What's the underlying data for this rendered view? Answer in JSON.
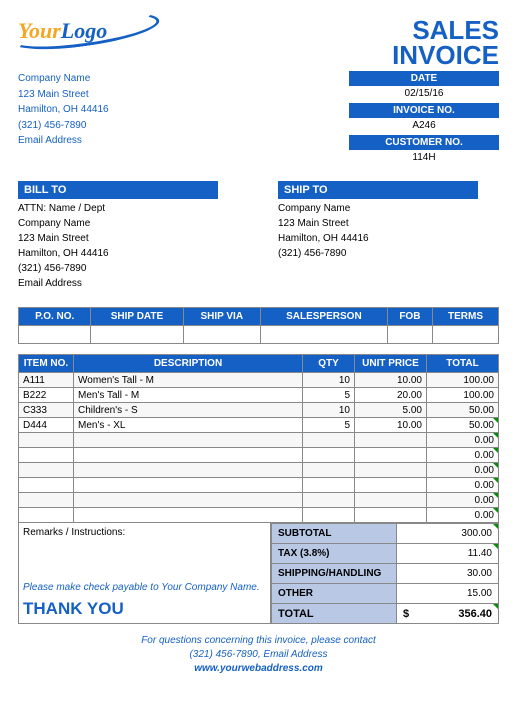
{
  "logo": {
    "word1": "Your",
    "word2": "Logo"
  },
  "title": {
    "line1": "SALES",
    "line2": "INVOICE"
  },
  "company": {
    "name": "Company Name",
    "street": "123 Main Street",
    "city": "Hamilton, OH  44416",
    "phone": "(321) 456-7890",
    "email": "Email Address"
  },
  "meta": {
    "date_label": "DATE",
    "date_value": "02/15/16",
    "invoice_label": "INVOICE NO.",
    "invoice_value": "A246",
    "customer_label": "CUSTOMER NO.",
    "customer_value": "114H"
  },
  "billto": {
    "header": "BILL TO",
    "attn": "ATTN: Name / Dept",
    "company": "Company Name",
    "street": "123 Main Street",
    "city": "Hamilton, OH  44416",
    "phone": "(321) 456-7890",
    "email": "Email Address"
  },
  "shipto": {
    "header": "SHIP TO",
    "company": "Company Name",
    "street": "123 Main Street",
    "city": "Hamilton, OH  44416",
    "phone": "(321) 456-7890"
  },
  "shiphdr": {
    "po": "P.O. NO.",
    "shipdate": "SHIP DATE",
    "shipvia": "SHIP VIA",
    "salesperson": "SALESPERSON",
    "fob": "FOB",
    "terms": "TERMS"
  },
  "itemshdr": {
    "item": "ITEM NO.",
    "desc": "DESCRIPTION",
    "qty": "QTY",
    "unit": "UNIT PRICE",
    "total": "TOTAL"
  },
  "items": [
    {
      "no": "A111",
      "desc": "Women's Tall - M",
      "qty": "10",
      "unit": "10.00",
      "total": "100.00"
    },
    {
      "no": "B222",
      "desc": "Men's Tall - M",
      "qty": "5",
      "unit": "20.00",
      "total": "100.00"
    },
    {
      "no": "C333",
      "desc": "Children's - S",
      "qty": "10",
      "unit": "5.00",
      "total": "50.00"
    },
    {
      "no": "D444",
      "desc": "Men's - XL",
      "qty": "5",
      "unit": "10.00",
      "total": "50.00"
    },
    {
      "no": "",
      "desc": "",
      "qty": "",
      "unit": "",
      "total": "0.00"
    },
    {
      "no": "",
      "desc": "",
      "qty": "",
      "unit": "",
      "total": "0.00"
    },
    {
      "no": "",
      "desc": "",
      "qty": "",
      "unit": "",
      "total": "0.00"
    },
    {
      "no": "",
      "desc": "",
      "qty": "",
      "unit": "",
      "total": "0.00"
    },
    {
      "no": "",
      "desc": "",
      "qty": "",
      "unit": "",
      "total": "0.00"
    },
    {
      "no": "",
      "desc": "",
      "qty": "",
      "unit": "",
      "total": "0.00"
    }
  ],
  "remarks_label": "Remarks / Instructions:",
  "payable": "Please make check payable to Your Company Name.",
  "thankyou": "THANK YOU",
  "totals": {
    "subtotal_label": "SUBTOTAL",
    "subtotal_value": "300.00",
    "tax_label": "TAX (3.8%)",
    "tax_value": "11.40",
    "ship_label": "SHIPPING/HANDLING",
    "ship_value": "30.00",
    "other_label": "OTHER",
    "other_value": "15.00",
    "total_label": "TOTAL",
    "total_currency": "$",
    "total_value": "356.40"
  },
  "footer": {
    "line1": "For questions concerning this invoice, please contact",
    "line2": "(321) 456-7890, Email Address",
    "url": "www.yourwebaddress.com"
  }
}
